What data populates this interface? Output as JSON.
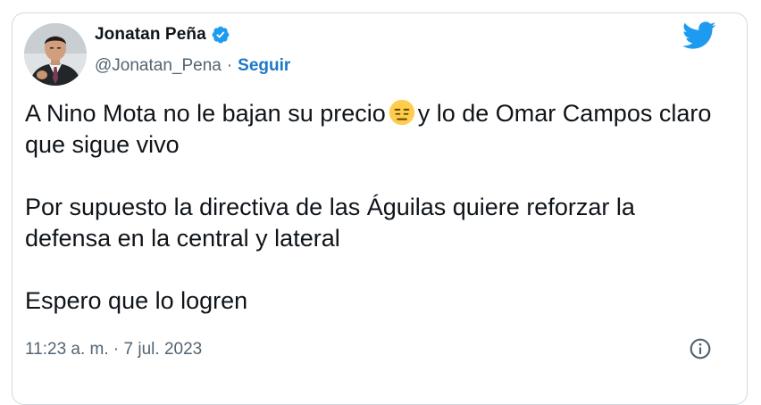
{
  "author": {
    "name": "Jonatan Peña",
    "handle": "@Jonatan_Pena",
    "separator": "·",
    "follow_label": "Seguir",
    "verified_icon": "verified-badge-icon",
    "avatar_icon": "profile-photo"
  },
  "brand_icon": "twitter-bird-icon",
  "tweet": {
    "line1_before_emoji": "A Nino Mota no le bajan su precio",
    "emoji_icon": "expressionless-face-emoji",
    "line1_after_emoji": "y lo de Omar Campos claro que sigue vivo",
    "paragraph2": "Por supuesto la directiva de las Águilas quiere reforzar la defensa en la central y lateral",
    "paragraph3": "Espero que lo logren"
  },
  "timestamp": "11:23 a. m. · 7 jul. 2023",
  "info_icon": "info-icon",
  "colors": {
    "twitter_blue": "#1d9bf0",
    "follow_blue": "#1d77c9",
    "text": "#0f1419",
    "secondary": "#536471",
    "border": "#cfd9de"
  }
}
